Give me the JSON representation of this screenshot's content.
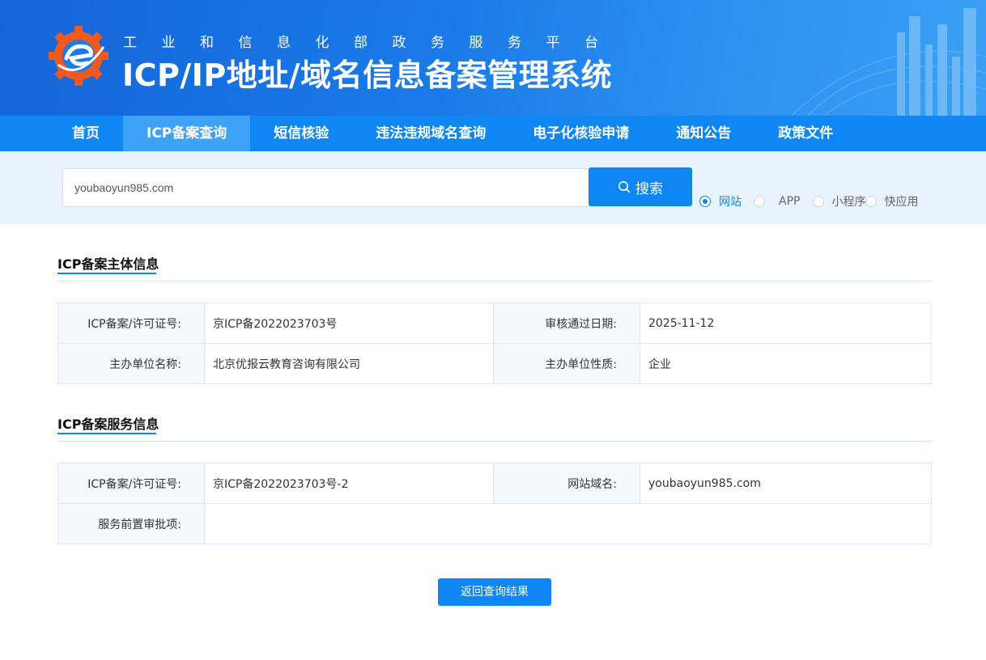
{
  "header": {
    "subtitle": "工业和信息化部政务服务平台",
    "title": "ICP/IP地址/域名信息备案管理系统"
  },
  "nav": {
    "items": [
      {
        "label": "首页",
        "active": false
      },
      {
        "label": "ICP备案查询",
        "active": true
      },
      {
        "label": "短信核验",
        "active": false
      },
      {
        "label": "违法违规域名查询",
        "active": false
      },
      {
        "label": "电子化核验申请",
        "active": false
      },
      {
        "label": "通知公告",
        "active": false
      },
      {
        "label": "政策文件",
        "active": false
      }
    ]
  },
  "search": {
    "value": "youbaoyun985.com",
    "button_label": "搜索",
    "button_icon": "search-icon",
    "types": [
      {
        "label": "网站",
        "selected": true
      },
      {
        "label": "APP",
        "selected": false
      },
      {
        "label": "小程序",
        "selected": false
      },
      {
        "label": "快应用",
        "selected": false
      }
    ]
  },
  "subject_section": {
    "title": "ICP备案主体信息",
    "license_label": "ICP备案/许可证号:",
    "license_value": "京ICP备2022023703号",
    "approve_date_label": "审核通过日期:",
    "approve_date_value": "2025-11-12",
    "org_name_label": "主办单位名称:",
    "org_name_value": "北京优报云教育咨询有限公司",
    "org_type_label": "主办单位性质:",
    "org_type_value": "企业"
  },
  "service_section": {
    "title": "ICP备案服务信息",
    "license_label": "ICP备案/许可证号:",
    "license_value": "京ICP备2022023703号-2",
    "domain_label": "网站域名:",
    "domain_value": "youbaoyun985.com",
    "pre_approval_label": "服务前置审批项:",
    "pre_approval_value": ""
  },
  "back_button_label": "返回查询结果",
  "colors": {
    "primary": "#0e86f4",
    "nav_active": "#3ea2f7",
    "banner_start": "#1565d8",
    "label_bg": "#f4f9fe",
    "search_strip_bg": "#e9f3fd",
    "logo_orange": "#f05a1e"
  }
}
